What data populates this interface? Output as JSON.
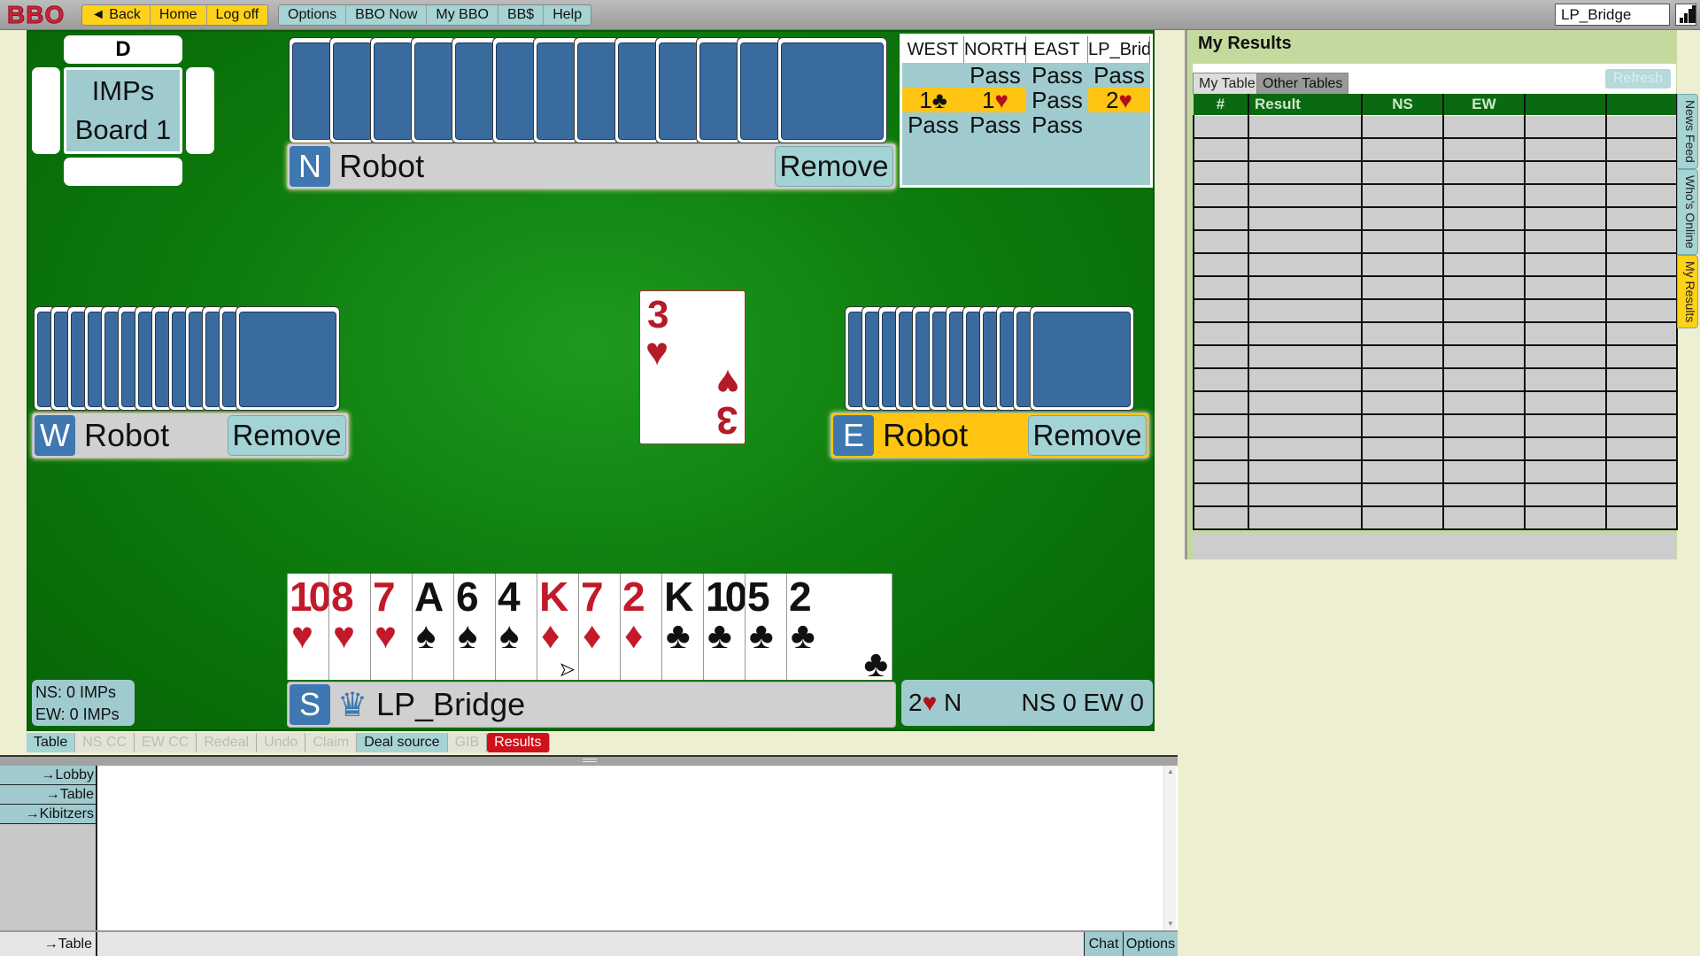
{
  "topbar": {
    "logo": "BBO",
    "nav": [
      "◄ Back",
      "Home",
      "Log off"
    ],
    "menu": [
      "Options",
      "BBO Now",
      "My BBO",
      "BB$",
      "Help"
    ],
    "username": "LP_Bridge"
  },
  "board": {
    "dealer": "D",
    "scoring": "IMPs",
    "board_label": "Board 1"
  },
  "players": {
    "north": {
      "seat": "N",
      "name": "Robot",
      "remove_label": "Remove",
      "cards": 13
    },
    "west": {
      "seat": "W",
      "name": "Robot",
      "remove_label": "Remove",
      "cards": 13
    },
    "east": {
      "seat": "E",
      "name": "Robot",
      "remove_label": "Remove",
      "cards": 12,
      "to_play": true
    },
    "south": {
      "seat": "S",
      "name": "LP_Bridge"
    }
  },
  "auction": {
    "headers": [
      "WEST",
      "NORTH",
      "EAST",
      "LP_Bridge"
    ],
    "rows": [
      [
        {
          "bid": ""
        },
        {
          "bid": "Pass"
        },
        {
          "bid": "Pass"
        },
        {
          "bid": "Pass"
        }
      ],
      [
        {
          "bid": "1♣",
          "hl": true,
          "suit": "club"
        },
        {
          "bid": "1♥",
          "hl": true,
          "suit": "heart"
        },
        {
          "bid": "Pass"
        },
        {
          "bid": "2♥",
          "hl": true,
          "suit": "heart"
        }
      ],
      [
        {
          "bid": "Pass"
        },
        {
          "bid": "Pass"
        },
        {
          "bid": "Pass"
        },
        {
          "bid": ""
        }
      ]
    ]
  },
  "played_card": {
    "rank": "3",
    "suit": "♥"
  },
  "south_hand": [
    {
      "rank": "10",
      "suit": "♥",
      "color": "red"
    },
    {
      "rank": "8",
      "suit": "♥",
      "color": "red"
    },
    {
      "rank": "7",
      "suit": "♥",
      "color": "red"
    },
    {
      "rank": "A",
      "suit": "♠",
      "color": "black"
    },
    {
      "rank": "6",
      "suit": "♠",
      "color": "black"
    },
    {
      "rank": "4",
      "suit": "♠",
      "color": "black"
    },
    {
      "rank": "K",
      "suit": "♦",
      "color": "red"
    },
    {
      "rank": "7",
      "suit": "♦",
      "color": "red"
    },
    {
      "rank": "2",
      "suit": "♦",
      "color": "red"
    },
    {
      "rank": "K",
      "suit": "♣",
      "color": "black"
    },
    {
      "rank": "10",
      "suit": "♣",
      "color": "black"
    },
    {
      "rank": "5",
      "suit": "♣",
      "color": "black"
    },
    {
      "rank": "2",
      "suit": "♣",
      "color": "black"
    }
  ],
  "score": {
    "ns": "NS:  0 IMPs",
    "ew": "EW:  0 IMPs"
  },
  "contract": {
    "level": "2",
    "suit": "♥",
    "declarer": "N",
    "tricks": "NS 0   EW 0"
  },
  "bottom_tabs": [
    {
      "label": "Table",
      "state": "on"
    },
    {
      "label": "NS CC",
      "state": "off"
    },
    {
      "label": "EW CC",
      "state": "off"
    },
    {
      "label": "Redeal",
      "state": "off"
    },
    {
      "label": "Undo",
      "state": "off"
    },
    {
      "label": "Claim",
      "state": "off"
    },
    {
      "label": "Deal source",
      "state": "on"
    },
    {
      "label": "GIB",
      "state": "off"
    },
    {
      "label": "Results",
      "state": "res"
    }
  ],
  "chat": {
    "destinations": [
      "→Lobby",
      "→Table",
      "→Kibitzers"
    ],
    "current_dest": "→Table",
    "input_value": "",
    "chat_label": "Chat",
    "options_label": "Options"
  },
  "results_panel": {
    "title": "My Results",
    "tabs": [
      "My Table",
      "Other Tables"
    ],
    "refresh_label": "Refresh",
    "columns": [
      "#",
      "Result",
      "NS",
      "EW",
      "",
      ""
    ],
    "rows": 18
  },
  "side_tabs": [
    {
      "label": "News Feed",
      "active": false
    },
    {
      "label": "Who's Online",
      "active": false
    },
    {
      "label": "My Results",
      "active": true
    }
  ],
  "colors": {
    "felt": "#0e7d0e",
    "card_back": "#3a6b9f",
    "highlight": "#ffc512",
    "panel_teal": "#9fcbcf",
    "results_red": "#d0101a"
  }
}
